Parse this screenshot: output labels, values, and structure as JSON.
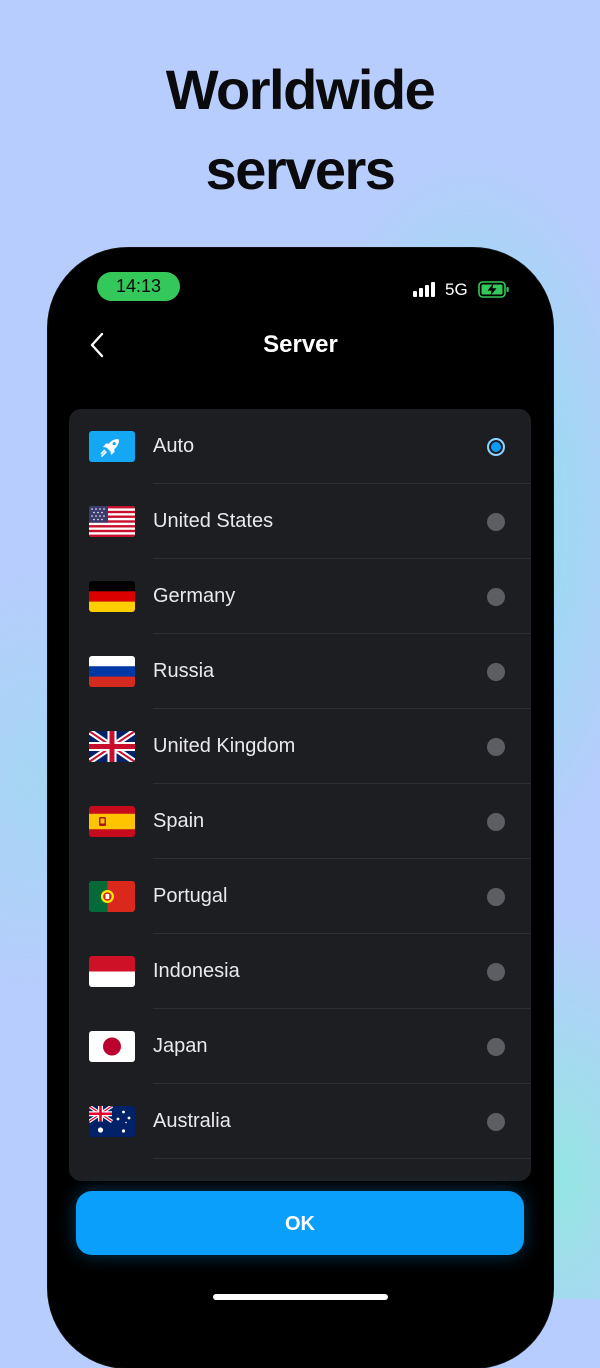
{
  "headline": {
    "line1": "Worldwide",
    "line2": "servers"
  },
  "status_bar": {
    "time": "14:13",
    "network": "5G",
    "time_pill_color": "#34c759",
    "signal_icon": "signal-bars-icon",
    "battery_icon": "battery-charging-icon"
  },
  "nav": {
    "title": "Server",
    "back_icon": "chevron-left-icon"
  },
  "servers": [
    {
      "label": "Auto",
      "icon": "rocket-icon",
      "selected": true
    },
    {
      "label": "United States",
      "icon": "flag-us-icon",
      "selected": false
    },
    {
      "label": "Germany",
      "icon": "flag-de-icon",
      "selected": false
    },
    {
      "label": "Russia",
      "icon": "flag-ru-icon",
      "selected": false
    },
    {
      "label": "United Kingdom",
      "icon": "flag-gb-icon",
      "selected": false
    },
    {
      "label": "Spain",
      "icon": "flag-es-icon",
      "selected": false
    },
    {
      "label": "Portugal",
      "icon": "flag-pt-icon",
      "selected": false
    },
    {
      "label": "Indonesia",
      "icon": "flag-id-icon",
      "selected": false
    },
    {
      "label": "Japan",
      "icon": "flag-jp-icon",
      "selected": false
    },
    {
      "label": "Australia",
      "icon": "flag-au-icon",
      "selected": false
    }
  ],
  "ok_button": {
    "label": "OK",
    "color": "#0a9ffa"
  },
  "colors": {
    "background": "#b7cdfd",
    "list_background": "#1d1e22",
    "radio_selected": "#0a9bf7",
    "radio_unselected": "#5d5e63"
  }
}
